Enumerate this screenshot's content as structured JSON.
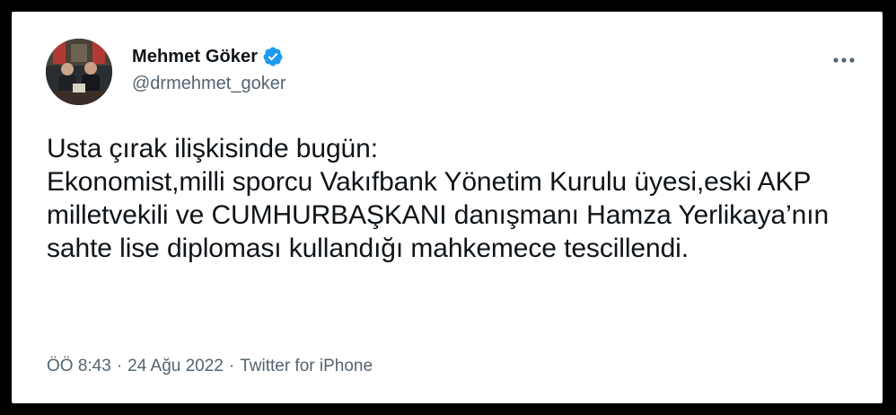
{
  "user": {
    "display_name": "Mehmet Göker",
    "handle": "@drmehmet_goker",
    "verified": true
  },
  "tweet": {
    "text": "Usta çırak ilişkisinde bugün:\nEkonomist,milli sporcu Vakıfbank Yönetim Kurulu üyesi,eski AKP milletvekili ve CUMHURBAŞKANI danışmanı Hamza Yerlikaya’nın sahte lise diploması kullandığı mahkemece tescillendi."
  },
  "meta": {
    "time": "ÖÖ 8:43",
    "separator": "·",
    "date": "24 Ağu 2022",
    "source": "Twitter for iPhone"
  },
  "icons": {
    "verified": "verified-badge-icon",
    "more": "more-options-icon"
  },
  "colors": {
    "verified_blue": "#1d9bf0",
    "text_primary": "#0f1419",
    "text_secondary": "#536471"
  }
}
